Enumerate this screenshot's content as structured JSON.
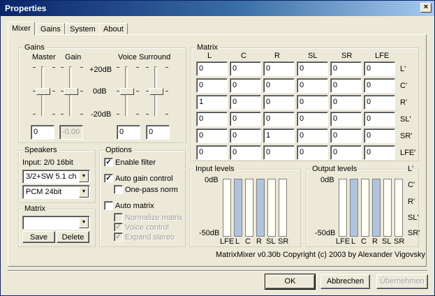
{
  "window": {
    "title": "Properties",
    "close_glyph": "×"
  },
  "tabs": [
    {
      "label": "Mixer",
      "active": true
    },
    {
      "label": "Gains",
      "active": false
    },
    {
      "label": "System",
      "active": false
    },
    {
      "label": "About",
      "active": false
    }
  ],
  "gains": {
    "label": "Gains",
    "master_label": "Master",
    "gain_label": "Gain",
    "voice_surround_label": "Voice Surround",
    "db_plus": "+20dB",
    "db_zero": "0dB",
    "db_minus": "-20dB",
    "master_value": "0",
    "gain_value": "-0.00",
    "voice_value": "0",
    "surround_value": "0"
  },
  "speakers": {
    "label": "Speakers",
    "input_text": "Input: 2/0 16bit",
    "config_value": "3/2+SW 5.1 ch",
    "format_value": "PCM 24bit"
  },
  "matrix_box": {
    "label": "Matrix",
    "combo_value": "",
    "save_label": "Save",
    "delete_label": "Delete"
  },
  "options": {
    "label": "Options",
    "enable_filter": {
      "label": "Enable filter",
      "checked": true
    },
    "auto_gain": {
      "label": "Auto gain control",
      "checked": true
    },
    "one_pass": {
      "label": "One-pass norm",
      "checked": false
    },
    "auto_matrix": {
      "label": "Auto matrix",
      "checked": false
    },
    "normalize": {
      "label": "Normalize matrix",
      "checked": false
    },
    "voice_control": {
      "label": "Voice control",
      "checked": true
    },
    "expand_stereo": {
      "label": "Expand stereo",
      "checked": true
    }
  },
  "matrix": {
    "label": "Matrix",
    "columns": [
      "L",
      "C",
      "R",
      "SL",
      "SR",
      "LFE"
    ],
    "rows": [
      "L'",
      "C'",
      "R'",
      "SL'",
      "SR'",
      "LFE'"
    ],
    "values": [
      [
        "0",
        "0",
        "0",
        "0",
        "0",
        "0"
      ],
      [
        "0",
        "0",
        "0",
        "0",
        "0",
        "0"
      ],
      [
        "1",
        "0",
        "0",
        "0",
        "0",
        "0"
      ],
      [
        "0",
        "0",
        "0",
        "0",
        "0",
        "0"
      ],
      [
        "0",
        "0",
        "1",
        "0",
        "0",
        "0"
      ],
      [
        "0",
        "0",
        "0",
        "0",
        "0",
        "0"
      ]
    ]
  },
  "input_levels": {
    "label": "Input levels",
    "top": "0dB",
    "bottom": "-50dB",
    "channels": [
      "LFE",
      "L",
      "C",
      "R",
      "SL",
      "SR"
    ]
  },
  "output_levels": {
    "label": "Output levels",
    "top": "0dB",
    "bottom": "-50dB",
    "channels": [
      "LFE",
      "L",
      "C",
      "R",
      "SL",
      "SR"
    ],
    "side_labels": [
      "L'",
      "C'",
      "R'",
      "SL'",
      "SR'"
    ]
  },
  "colors": {
    "level_bar_active": "#b0c4de",
    "level_bar_idle": "#fffff5"
  },
  "copyright": "MatrixMixer v0.30b Copyright (c) 2003 by Alexander Vigovsky",
  "buttons": {
    "ok": "OK",
    "cancel": "Abbrechen",
    "apply": "Übernehmen"
  }
}
